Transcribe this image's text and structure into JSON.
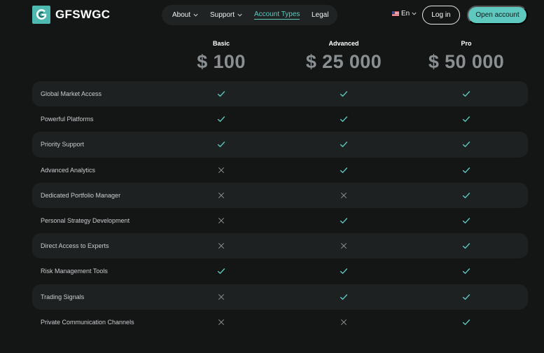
{
  "brand": {
    "name": "GFSWGC"
  },
  "nav": {
    "items": [
      {
        "label": "About",
        "has_dropdown": true,
        "active": false
      },
      {
        "label": "Support",
        "has_dropdown": true,
        "active": false
      },
      {
        "label": "Account Types",
        "has_dropdown": false,
        "active": true
      },
      {
        "label": "Legal",
        "has_dropdown": false,
        "active": false
      }
    ]
  },
  "language": {
    "label": "En",
    "flag": "us-flag-icon"
  },
  "actions": {
    "login_label": "Log in",
    "open_account_label": "Open account"
  },
  "colors": {
    "accent": "#5fc9bf",
    "background": "#141616",
    "row_shade": "#1d2121",
    "price": "#8a8f92"
  },
  "plans": [
    {
      "name": "Basic",
      "price": "$ 100"
    },
    {
      "name": "Advanced",
      "price": "$ 25 000"
    },
    {
      "name": "Pro",
      "price": "$ 50 000"
    }
  ],
  "features": [
    {
      "name": "Global Market Access",
      "included": [
        true,
        true,
        true
      ]
    },
    {
      "name": "Powerful Platforms",
      "included": [
        true,
        true,
        true
      ]
    },
    {
      "name": "Priority Support",
      "included": [
        true,
        true,
        true
      ]
    },
    {
      "name": "Advanced Analytics",
      "included": [
        false,
        true,
        true
      ]
    },
    {
      "name": "Dedicated Portfolio Manager",
      "included": [
        false,
        false,
        true
      ]
    },
    {
      "name": "Personal Strategy Development",
      "included": [
        false,
        true,
        true
      ]
    },
    {
      "name": "Direct Access to Experts",
      "included": [
        false,
        false,
        true
      ]
    },
    {
      "name": "Risk Management Tools",
      "included": [
        true,
        true,
        true
      ]
    },
    {
      "name": "Trading Signals",
      "included": [
        false,
        true,
        true
      ]
    },
    {
      "name": "Private Communication Channels",
      "included": [
        false,
        false,
        true
      ]
    }
  ]
}
